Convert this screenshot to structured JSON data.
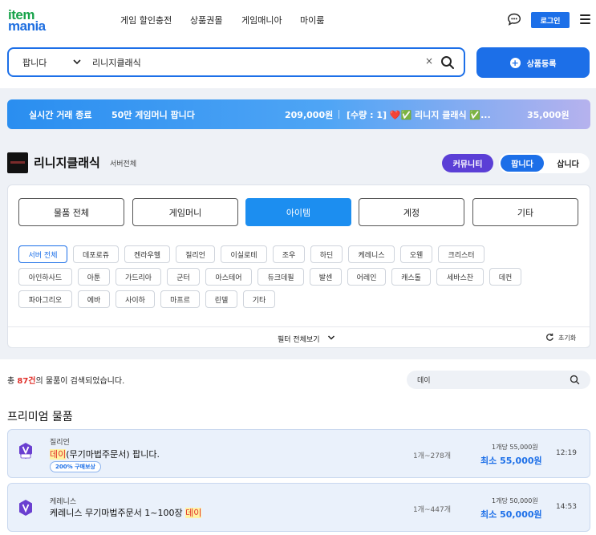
{
  "header": {
    "logo_top": "item",
    "logo_bottom": "mania",
    "nav": [
      "게임 할인충전",
      "상품권몰",
      "게임매니아",
      "마이룸"
    ],
    "login": "로그인"
  },
  "search": {
    "type": "팝니다",
    "query": "리니지클래식",
    "clear": "×"
  },
  "register_button": "상품등록",
  "live_banner": {
    "label": "실시간 거래 종료",
    "item1_title": "50만 게임머니 팝니다",
    "item1_price": "209,000원",
    "item2_title": "[수량 : 1] ❤️✅ 리니지 클래식 ✅...",
    "item2_price": "35,000원"
  },
  "game": {
    "title": "리니지클래식",
    "server": "서버전체",
    "community": "커뮤니티",
    "sell": "팝니다",
    "buy": "삽니다"
  },
  "categories": [
    {
      "label": "물품 전체",
      "active": false
    },
    {
      "label": "게임머니",
      "active": false
    },
    {
      "label": "아이템",
      "active": true
    },
    {
      "label": "계정",
      "active": false
    },
    {
      "label": "기타",
      "active": false
    }
  ],
  "servers_row1": [
    "서버 전체",
    "데포로쥬",
    "켄라우헬",
    "질리언",
    "이실로테",
    "조우",
    "하딘",
    "케레니스",
    "오웬",
    "크리스터"
  ],
  "servers_row2": [
    "아인하사드",
    "아툰",
    "가드리아",
    "군터",
    "아스테어",
    "듀크데필",
    "발센",
    "어레인",
    "캐스톨",
    "세바스찬",
    "데컨"
  ],
  "servers_row3": [
    "파아그리오",
    "에바",
    "사이하",
    "마프르",
    "린델",
    "기타"
  ],
  "filter": {
    "show_all": "필터 전체보기",
    "reset": "초기화"
  },
  "results": {
    "prefix": "총 ",
    "count": "87건",
    "suffix": "의 물품이 검색되었습니다.",
    "sub_search": "데이"
  },
  "premium_title": "프리미엄 물품",
  "listings": [
    {
      "server": "질리언",
      "title_hl": "데이",
      "title_rest": "(무기마법주문서) 팝니다.",
      "badge": "200% 구매보상",
      "qty": "1개~278개",
      "unit_price": "1개당 55,000원",
      "min_price": "최소 55,000원",
      "time": "12:19"
    },
    {
      "server": "케레니스",
      "title_rest": "케레니스 무기마법주문서 1~100장 ",
      "title_hl": "데이",
      "qty": "1개~447개",
      "unit_price": "1개당 50,000원",
      "min_price": "최소 50,000원",
      "time": "14:53"
    }
  ],
  "colors": {
    "primary": "#1c6fe8",
    "community": "#5b3fd6",
    "highlight_text": "#e0302a",
    "badge_purple": "#6a3fd0"
  }
}
